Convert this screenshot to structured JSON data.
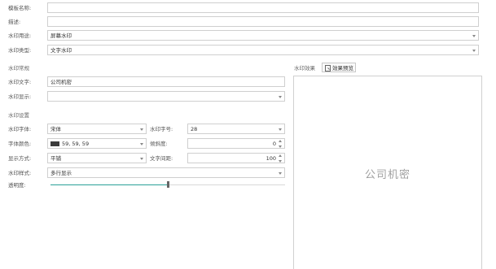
{
  "form": {
    "template_name": {
      "label": "模板名称:",
      "value": ""
    },
    "description": {
      "label": "描述:",
      "value": ""
    },
    "watermark_usage": {
      "label": "水印用途:",
      "value": "屏幕水印"
    },
    "watermark_type": {
      "label": "水印类型:",
      "value": "文字水印"
    }
  },
  "sections": {
    "content": "水印常规",
    "settings": "水印设置"
  },
  "content": {
    "watermark_text": {
      "label": "水印文字:",
      "value": "公司机密"
    },
    "watermark_display": {
      "label": "水印显示:",
      "value": ""
    }
  },
  "settings": {
    "font": {
      "label": "水印字体:",
      "value": "宋体"
    },
    "font_size": {
      "label": "水印字号:",
      "value": "28"
    },
    "font_color": {
      "label": "字体颜色:",
      "value": "59, 59, 59",
      "swatch": "#3b3b3b"
    },
    "tilt": {
      "label": "倾斜度:",
      "value": "0"
    },
    "display_mode": {
      "label": "显示方式:",
      "value": "平铺"
    },
    "text_spacing": {
      "label": "文字间距:",
      "value": "100"
    },
    "style": {
      "label": "水印样式:",
      "value": "多行显示"
    },
    "transparency": {
      "label": "透明度:",
      "level": 0.5
    }
  },
  "preview": {
    "label": "水印效果",
    "button_label": "效果预览",
    "watermark_text": "公司机密"
  },
  "colors": {
    "slider_fill": "#2aa198",
    "border": "#cfcfcf"
  }
}
